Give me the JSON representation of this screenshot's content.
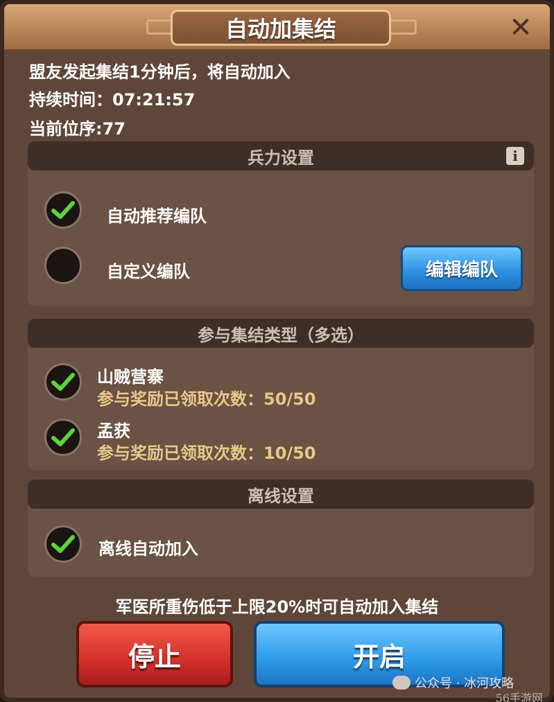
{
  "dialog": {
    "title": "自动加集结",
    "close_label": "✕"
  },
  "info": {
    "line1": "盟友发起集结1分钟后，将自动加入",
    "line2": "持续时间：07:21:57",
    "line3": "当前位序:77"
  },
  "troop_settings": {
    "header": "兵力设置",
    "info_icon": "i",
    "options": [
      {
        "label": "自动推荐编队",
        "checked": true
      },
      {
        "label": "自定义编队",
        "checked": false
      }
    ],
    "edit_button": "编辑编队"
  },
  "rally_types": {
    "header": "参与集结类型（多选）",
    "items": [
      {
        "name": "山贼营寨",
        "reward": "参与奖励已领取次数：50/50",
        "checked": true
      },
      {
        "name": "孟获",
        "reward": "参与奖励已领取次数：10/50",
        "checked": true
      }
    ]
  },
  "offline": {
    "header": "离线设置",
    "option": "离线自动加入",
    "checked": true
  },
  "notice": "军医所重伤低于上限20%时可自动加入集结",
  "buttons": {
    "stop": "停止",
    "start": "开启"
  },
  "watermark": {
    "text": "公众号 · 冰河攻略",
    "site": "56手游网"
  },
  "colors": {
    "check_green": "#5fd33a",
    "reward_text": "#e8c888",
    "panel": "#6a5244"
  }
}
